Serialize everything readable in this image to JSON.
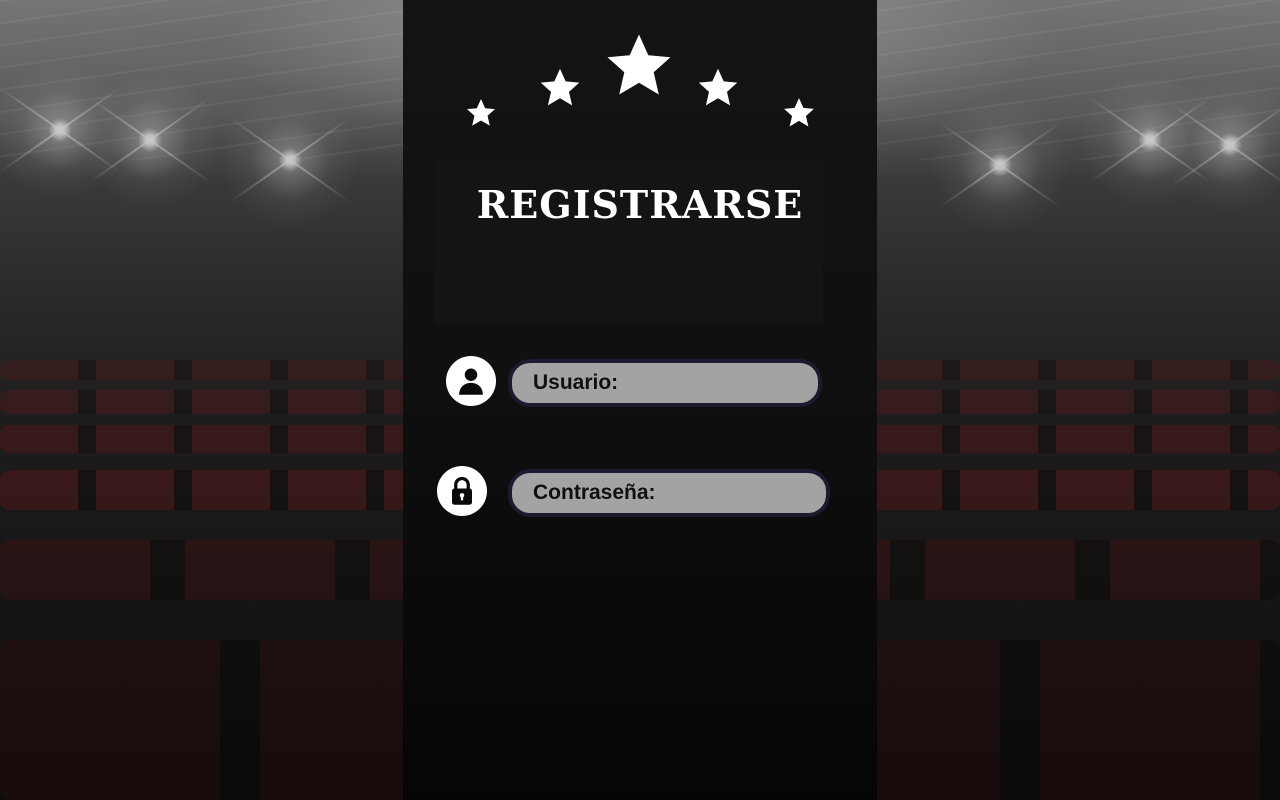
{
  "title": "REGISTRARSE",
  "fields": {
    "user": {
      "label": "Usuario:",
      "icon": "user-icon"
    },
    "password": {
      "label": "Contraseña:",
      "icon": "lock-icon"
    }
  },
  "decor": {
    "stars_icon": "star-icon",
    "stars_count": 5
  },
  "colors": {
    "panel": "#111111",
    "field_fill": "#a3a3a3",
    "field_border": "#1d1a30",
    "text_light": "#ffffff",
    "seat_red": "#6e2424"
  }
}
